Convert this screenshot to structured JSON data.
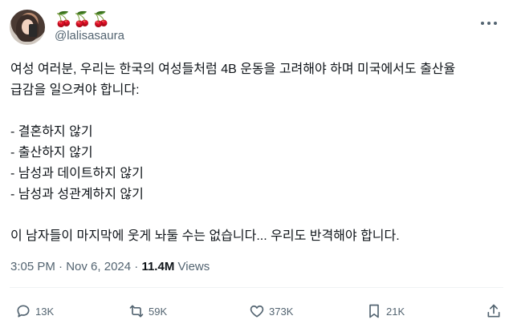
{
  "user": {
    "display_name": "🍒🍒🍒",
    "handle": "@lalisasaura"
  },
  "tweet": {
    "lines": [
      "여성 여러분, 우리는 한국의 여성들처럼 4B 운동을 고려해야 하며 미국에서도 출산율",
      "급감을 일으켜야 합니다:"
    ],
    "list": [
      "- 결혼하지 않기",
      "- 출산하지 않기",
      "- 남성과 데이트하지 않기",
      "- 남성과 성관계하지 않기"
    ],
    "closing": "이 남자들이 마지막에 웃게 놔둘 수는 없습니다... 우리도 반격해야 합니다."
  },
  "meta": {
    "time": "3:05 PM",
    "date": "Nov 6, 2024",
    "views_count": "11.4M",
    "views_label": "Views"
  },
  "actions": {
    "replies": "13K",
    "retweets": "59K",
    "likes": "373K",
    "bookmarks": "21K"
  },
  "icons": {
    "more": "more-horizontal-icon",
    "reply": "speech-bubble-icon",
    "retweet": "retweet-icon",
    "like": "heart-icon",
    "bookmark": "bookmark-icon",
    "share": "share-upload-icon"
  },
  "colors": {
    "text": "#0f1419",
    "secondary": "#536471",
    "divider": "#eff3f4"
  }
}
